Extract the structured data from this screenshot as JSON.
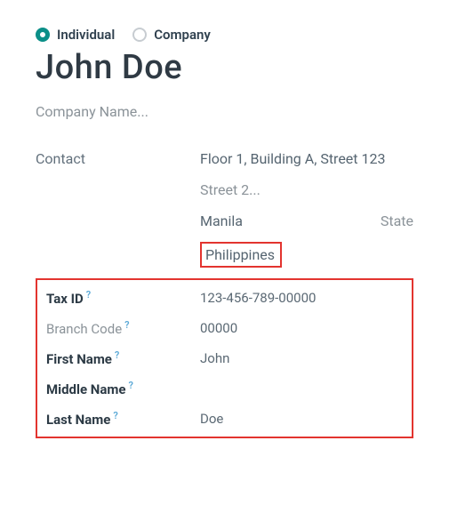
{
  "type_selector": {
    "individual": "Individual",
    "company": "Company"
  },
  "title": "John Doe",
  "company_name_placeholder": "Company Name...",
  "contact_label": "Contact",
  "address": {
    "street1": "Floor 1, Building A, Street 123",
    "street2_placeholder": "Street 2...",
    "city": "Manila",
    "state_placeholder": "State",
    "country": "Philippines"
  },
  "fields": {
    "tax_id": {
      "label": "Tax ID",
      "help": "?",
      "value": "123-456-789-00000"
    },
    "branch_code": {
      "label": "Branch Code",
      "help": "?",
      "value": "00000"
    },
    "first_name": {
      "label": "First Name",
      "help": "?",
      "value": "John"
    },
    "middle_name": {
      "label": "Middle Name",
      "help": "?",
      "value": ""
    },
    "last_name": {
      "label": "Last Name",
      "help": "?",
      "value": "Doe"
    }
  }
}
